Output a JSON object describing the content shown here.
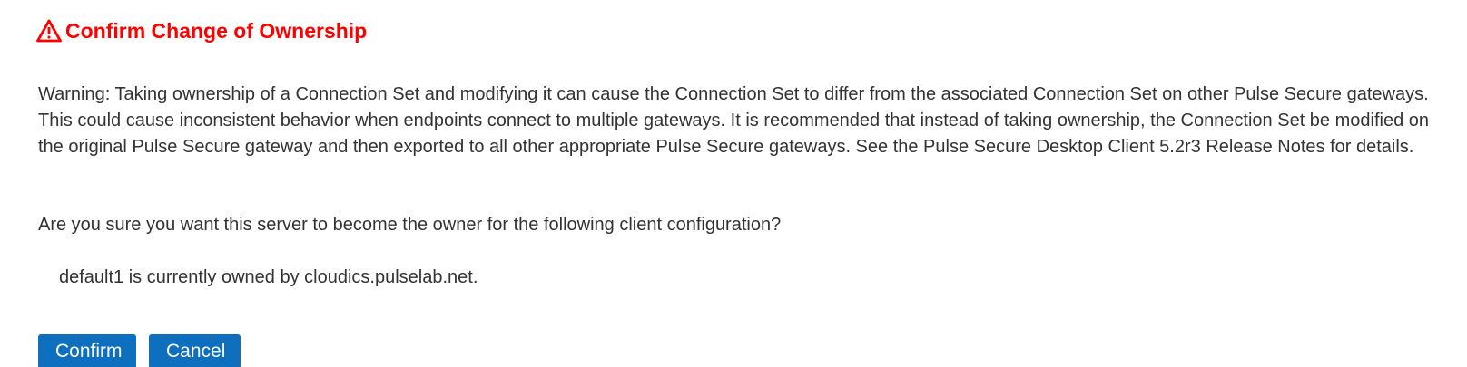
{
  "dialog": {
    "icon": "warning-triangle-icon",
    "title": "Confirm Change of Ownership",
    "title_color": "#ff0000",
    "warning_text": "Warning: Taking ownership of a Connection Set and modifying it can cause the Connection Set to differ from the associated Connection Set on other Pulse Secure gateways. This could cause inconsistent behavior when endpoints connect to multiple gateways. It is recommended that instead of taking ownership, the Connection Set be modified on the original Pulse Secure gateway and then exported to all other appropriate Pulse Secure gateways. See the Pulse Secure Desktop Client 5.2r3 Release Notes for details.",
    "question": "Are you sure you want this server to become the owner for the following client configuration?",
    "owner_line": "default1 is currently owned by cloudics.pulselab.net."
  },
  "buttons": {
    "confirm_label": "Confirm",
    "cancel_label": "Cancel",
    "color": "#0f6fbf"
  }
}
